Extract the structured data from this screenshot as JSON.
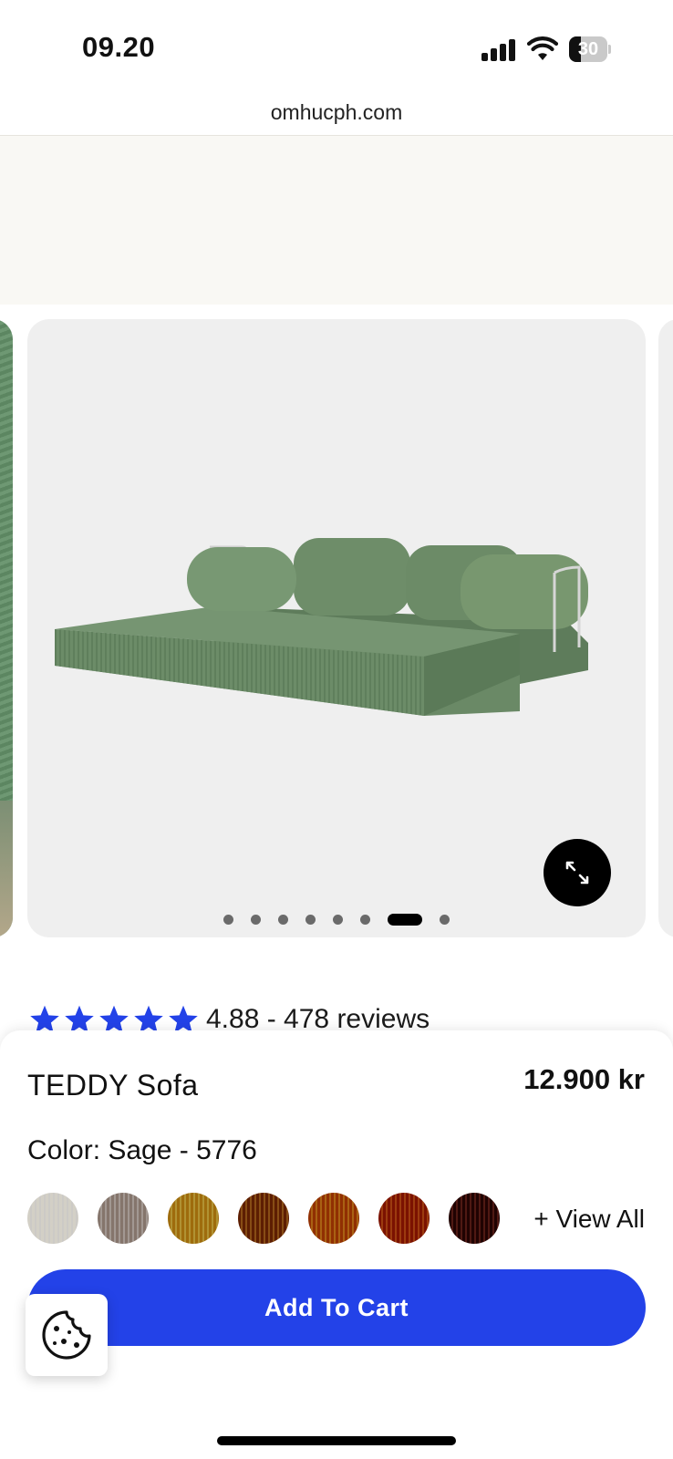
{
  "status_bar": {
    "time": "09.20",
    "battery_level": "30",
    "battery_fraction": 0.3
  },
  "browser": {
    "url": "omhucph.com"
  },
  "carousel": {
    "slide_count": 8,
    "active_slide": 7,
    "expand_icon": "expand-arrows-icon"
  },
  "rating": {
    "stars": 5,
    "text": "4.88 - 478 reviews",
    "star_color": "#2342e8"
  },
  "product": {
    "name": "TEDDY Sofa",
    "price": "12.900 kr",
    "color_label": "Color: Sage - 5776",
    "swatches": [
      {
        "name": "white",
        "color": "#e8e6e1"
      },
      {
        "name": "taupe",
        "color": "#b8ada6"
      },
      {
        "name": "mustard",
        "color": "#c9a63a"
      },
      {
        "name": "caramel",
        "color": "#9a5818"
      },
      {
        "name": "amber",
        "color": "#c06e16"
      },
      {
        "name": "rust",
        "color": "#b14311"
      },
      {
        "name": "burgundy",
        "color": "#5a1c16"
      }
    ],
    "view_all_label": "+ View All",
    "add_to_cart_label": "Add To Cart",
    "accent_color": "#2342e8"
  }
}
